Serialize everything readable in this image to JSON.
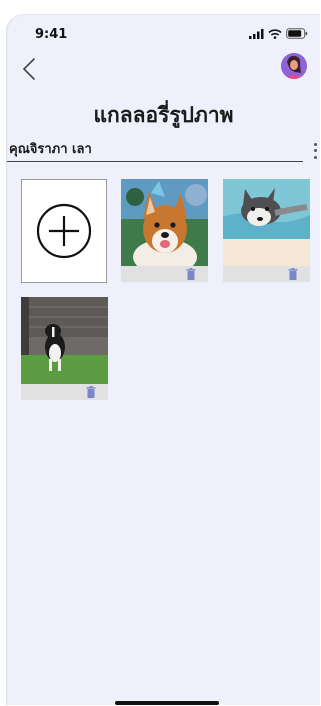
{
  "status_bar": {
    "time": "9:41"
  },
  "header": {
    "title": "แกลลอรี่รูปภาพ"
  },
  "subheader": {
    "name": "คุณจิราภา เลา"
  },
  "gallery": {
    "photos": [
      {
        "subject": "corgi-with-party-hat"
      },
      {
        "subject": "husky-swimming"
      },
      {
        "subject": "border-collie-on-lawn"
      }
    ]
  },
  "colors": {
    "background": "#eef1fb",
    "accent": "#8e63d6",
    "delete_icon": "#7b86c8"
  }
}
